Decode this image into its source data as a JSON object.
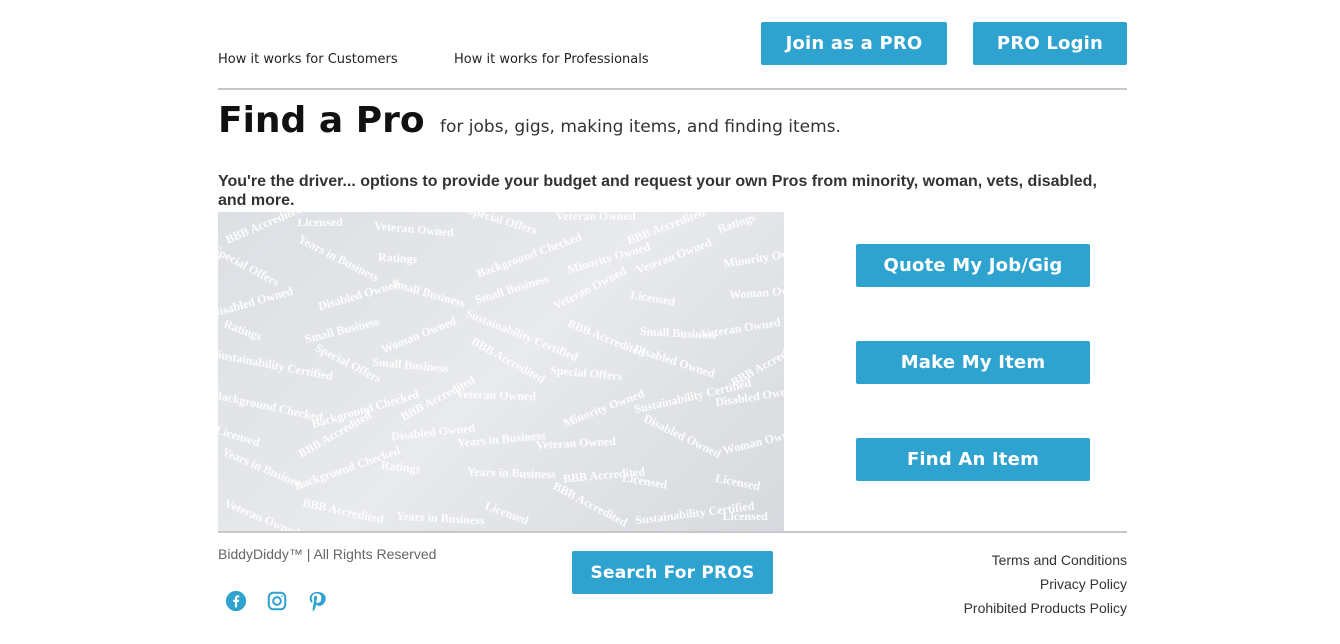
{
  "header": {
    "nav": [
      "How it works for Customers",
      "How it works for Professionals"
    ],
    "join_label": "Join as a PRO",
    "login_label": "PRO Login"
  },
  "main": {
    "title": "Find a Pro",
    "subtitle": "for jobs, gigs, making items, and finding items.",
    "intro": "You're the driver... options to provide your budget and request your own Pros from minority, woman, vets, disabled, and more.",
    "hero_words": [
      "BBB Accredited",
      "Licensed",
      "Veteran Owned",
      "Special Offers",
      "Veteran Owned",
      "BBB Accredited",
      "Ratings",
      "Special Offers",
      "Years in Business",
      "Ratings",
      "Background Checked",
      "Minority Owned",
      "Veteran Owned",
      "Minority Owned",
      "Disabled Owned",
      "Disabled Owned",
      "Small Business",
      "Small Business",
      "Veteran Owned",
      "Licensed",
      "Woman Owned",
      "Ratings",
      "Small Business",
      "Woman Owned",
      "Sustainability Certified",
      "BBB Accredited",
      "Small Business",
      "Veteran Owned",
      "Sustainability Certified",
      "Special Offers",
      "Small Business",
      "BBB Accredited",
      "Special Offers",
      "Disabled Owned",
      "BBB Accredited",
      "Background Checked",
      "Background Checked",
      "BBB Accredited",
      "Veteran Owned",
      "Minority Owned",
      "Sustainability Certified",
      "Disabled Owned",
      "Licensed",
      "BBB Accredited",
      "Disabled Owned",
      "Years in Business",
      "Veteran Owned",
      "Disabled Owned",
      "Woman Owned",
      "Years in Business",
      "Background Checked",
      "Ratings",
      "Years in Business",
      "BBB Accredited",
      "Licensed",
      "Licensed",
      "Veteran Owned",
      "BBB Accredited",
      "Years in Business",
      "Licensed",
      "BBB Accredited",
      "Sustainability Certified",
      "Licensed"
    ],
    "actions": [
      "Quote My Job/Gig",
      "Make My Item",
      "Find An Item"
    ]
  },
  "footer": {
    "copyright": "BiddyDiddy™ | All Rights Reserved",
    "search_label": "Search For PROS",
    "links": [
      "Terms and Conditions",
      "Privacy Policy",
      "Prohibited Products Policy"
    ],
    "social_icons": [
      "facebook-icon",
      "instagram-icon",
      "pinterest-icon"
    ],
    "accent_color": "#2fa3cf"
  }
}
